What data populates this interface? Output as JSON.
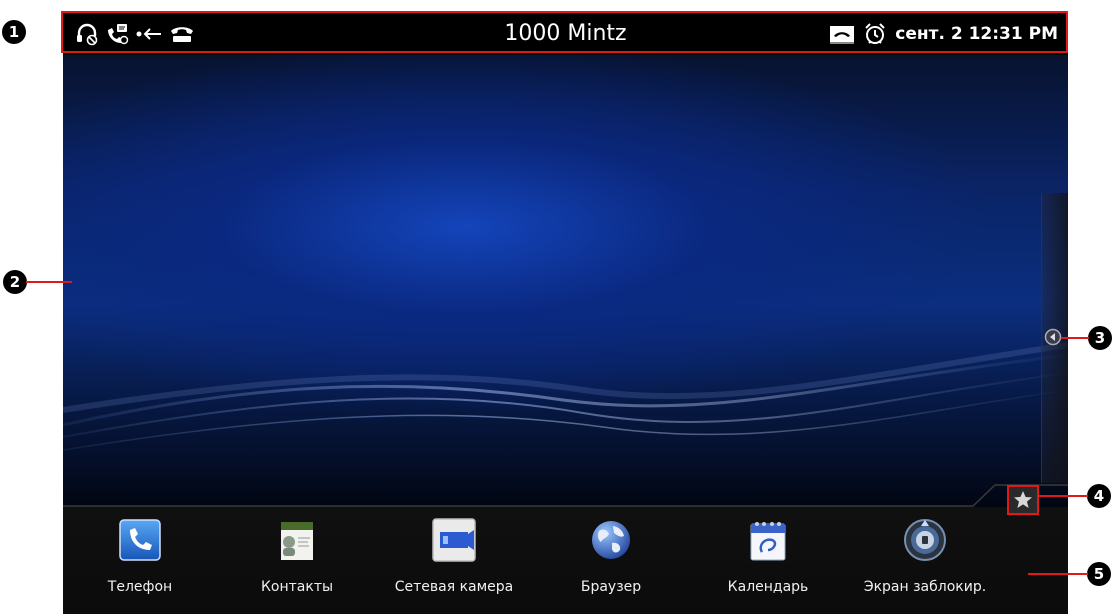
{
  "status_bar": {
    "title": "1000  Mintz",
    "datetime": "сент. 2 12:31 PM",
    "left_icons": [
      "headset-icon",
      "voicemail-phone-icon",
      "call-forward-icon",
      "phone-handset-icon"
    ],
    "right_icons": [
      "phone-hangup-icon",
      "alarm-clock-icon"
    ]
  },
  "dock": {
    "items": [
      {
        "label": "Телефон",
        "icon": "phone-icon"
      },
      {
        "label": "Контакты",
        "icon": "contacts-icon"
      },
      {
        "label": "Сетевая камера",
        "icon": "network-camera-icon"
      },
      {
        "label": "Браузер",
        "icon": "globe-icon"
      },
      {
        "label": "Календарь",
        "icon": "calendar-icon"
      },
      {
        "label": "Экран заблокир.",
        "icon": "screen-lock-icon"
      }
    ]
  },
  "callouts": [
    "1",
    "2",
    "3",
    "4",
    "5"
  ],
  "colors": {
    "callout_red": "#e01a1a",
    "status_bar": "#000000",
    "wallpaper_blue": "#0b2e7f"
  }
}
